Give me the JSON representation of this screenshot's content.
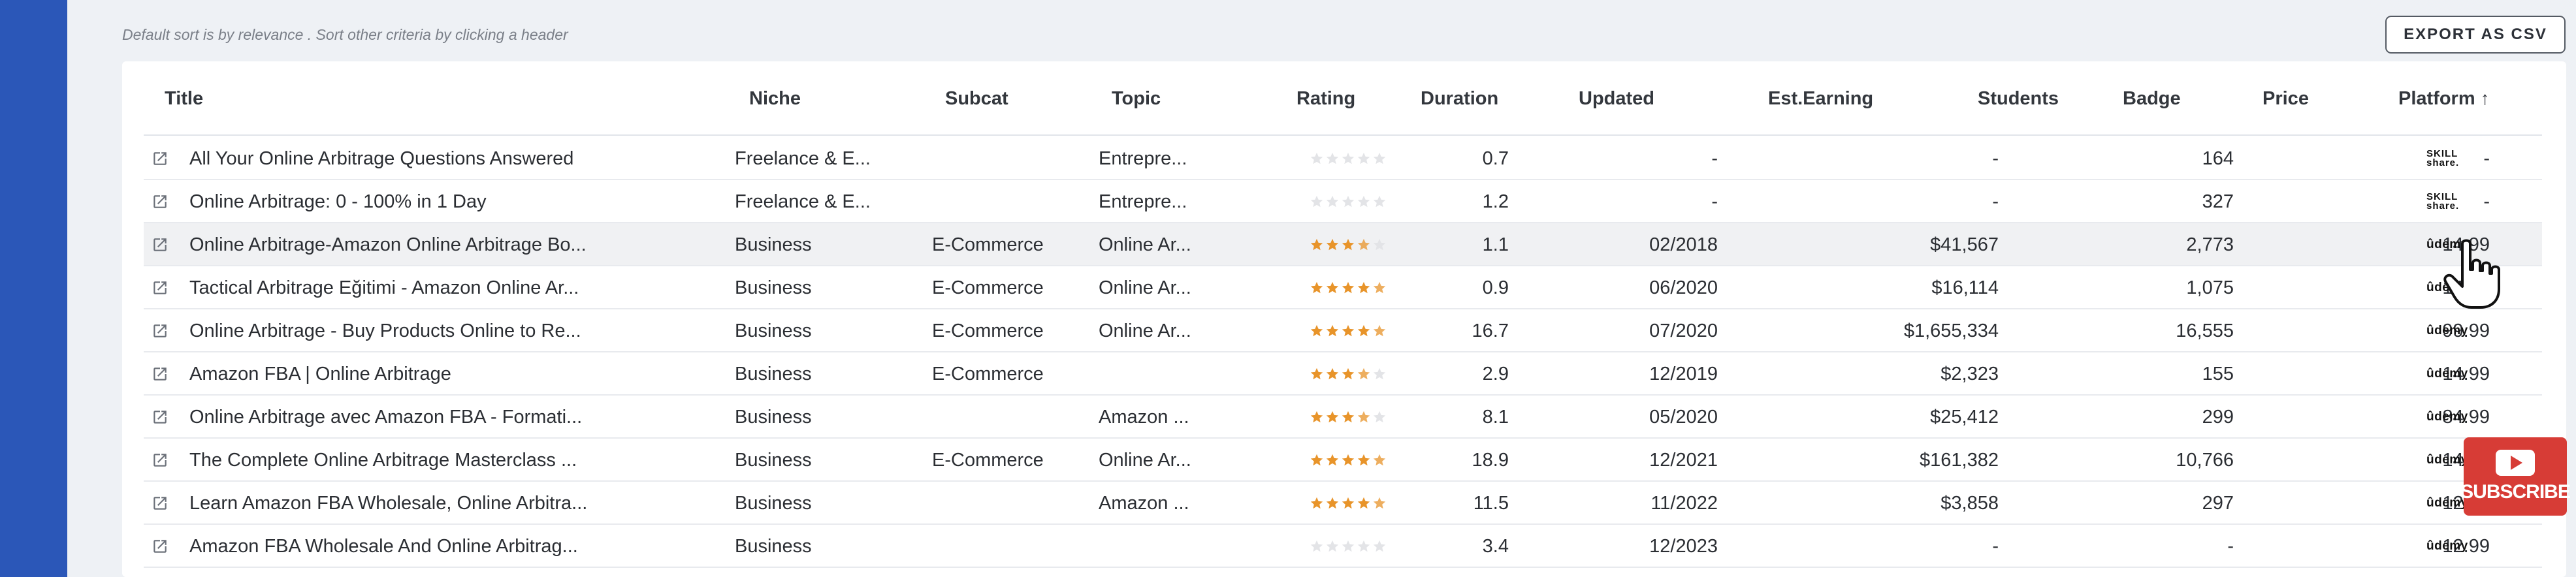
{
  "hint_text": "Default sort is by relevance . Sort other criteria by clicking a header",
  "export_label": "EXPORT AS CSV",
  "columns": {
    "title": "Title",
    "niche": "Niche",
    "subcat": "Subcat",
    "topic": "Topic",
    "rating": "Rating",
    "duration": "Duration",
    "updated": "Updated",
    "earning": "Est.Earning",
    "students": "Students",
    "badge": "Badge",
    "price": "Price",
    "platform": "Platform"
  },
  "sort_indicator": "↑",
  "rows": [
    {
      "title": "All Your Online Arbitrage Questions Answered",
      "niche": "Freelance & E...",
      "subcat": "",
      "topic": "Entrepre...",
      "rating": 0,
      "duration": "0.7",
      "updated": "-",
      "earning": "-",
      "students": "164",
      "badge": "",
      "price": "-",
      "platform": "skillshare"
    },
    {
      "title": "Online Arbitrage: 0 - 100% in 1 Day",
      "niche": "Freelance & E...",
      "subcat": "",
      "topic": "Entrepre...",
      "rating": 0,
      "duration": "1.2",
      "updated": "-",
      "earning": "-",
      "students": "327",
      "badge": "",
      "price": "-",
      "platform": "skillshare"
    },
    {
      "title": "Online Arbitrage-Amazon Online Arbitrage Bo...",
      "niche": "Business",
      "subcat": "E-Commerce",
      "topic": "Online Ar...",
      "rating": 3.5,
      "duration": "1.1",
      "updated": "02/2018",
      "earning": "$41,567",
      "students": "2,773",
      "badge": "",
      "price": "14.99",
      "platform": "udemy"
    },
    {
      "title": "Tactical Arbitrage Eğitimi - Amazon Online Ar...",
      "niche": "Business",
      "subcat": "E-Commerce",
      "topic": "Online Ar...",
      "rating": 4.5,
      "duration": "0.9",
      "updated": "06/2020",
      "earning": "$16,114",
      "students": "1,075",
      "badge": "",
      "price": "14.99",
      "platform": "udemy"
    },
    {
      "title": "Online Arbitrage - Buy Products Online to Re...",
      "niche": "Business",
      "subcat": "E-Commerce",
      "topic": "Online Ar...",
      "rating": 4.5,
      "duration": "16.7",
      "updated": "07/2020",
      "earning": "$1,655,334",
      "students": "16,555",
      "badge": "",
      "price": "99.99",
      "platform": "udemy"
    },
    {
      "title": "Amazon FBA | Online Arbitrage",
      "niche": "Business",
      "subcat": "E-Commerce",
      "topic": "",
      "rating": 3.5,
      "duration": "2.9",
      "updated": "12/2019",
      "earning": "$2,323",
      "students": "155",
      "badge": "",
      "price": "14.99",
      "platform": "udemy"
    },
    {
      "title": "Online Arbitrage avec Amazon FBA - Formati...",
      "niche": "Business",
      "subcat": "",
      "topic": "Amazon ...",
      "rating": 3.5,
      "duration": "8.1",
      "updated": "05/2020",
      "earning": "$25,412",
      "students": "299",
      "badge": "",
      "price": "84.99",
      "platform": "udemy"
    },
    {
      "title": "The Complete Online Arbitrage Masterclass ...",
      "niche": "Business",
      "subcat": "E-Commerce",
      "topic": "Online Ar...",
      "rating": 4.5,
      "duration": "18.9",
      "updated": "12/2021",
      "earning": "$161,382",
      "students": "10,766",
      "badge": "",
      "price": "14.99",
      "platform": "udemy"
    },
    {
      "title": "Learn Amazon FBA Wholesale, Online Arbitra...",
      "niche": "Business",
      "subcat": "",
      "topic": "Amazon ...",
      "rating": 4.5,
      "duration": "11.5",
      "updated": "11/2022",
      "earning": "$3,858",
      "students": "297",
      "badge": "",
      "price": "12.99",
      "platform": "udemy"
    },
    {
      "title": "Amazon FBA Wholesale And Online Arbitrag...",
      "niche": "Business",
      "subcat": "",
      "topic": "",
      "rating": 0,
      "duration": "3.4",
      "updated": "12/2023",
      "earning": "-",
      "students": "-",
      "badge": "",
      "price": "12.99",
      "platform": "udemy"
    }
  ],
  "platform_logos": {
    "skillshare_line1": "SKILL",
    "skillshare_line2": "share.",
    "udemy": "ûdemy"
  },
  "colors": {
    "sidebar": "#2b57b8",
    "star_filled": "#e8942a",
    "star_empty": "#e3e4e7",
    "highlight_row": "#f0f1f3"
  },
  "icons": {
    "row_link": "open-in-new-icon",
    "cursor": "hand-pointer-icon"
  },
  "overlay": {
    "subscribe_label": "SUBSCRIBE"
  }
}
